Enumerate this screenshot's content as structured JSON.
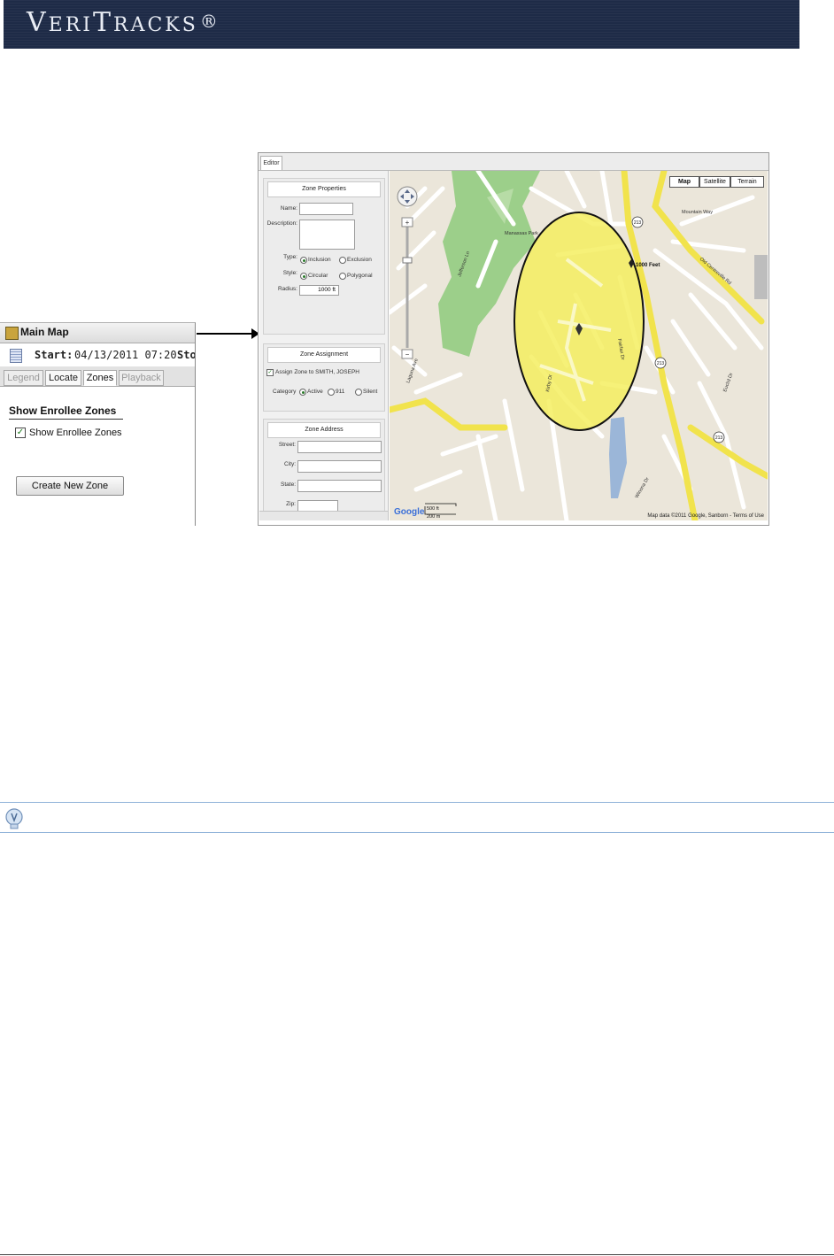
{
  "banner": {
    "brand": "VeriTracks",
    "brand_parts": [
      "V",
      "ERI",
      "T",
      "RACKS"
    ],
    "registered": "®",
    "bg_color": "#1e2b47"
  },
  "main_map_panel": {
    "title": "Main Map",
    "start_label": "Start:",
    "start_value": "04/13/2011 07:20",
    "stop_label": "Sto",
    "tabs": [
      {
        "label": "Legend",
        "state": "disabled"
      },
      {
        "label": "Locate",
        "state": "enabled"
      },
      {
        "label": "Zones",
        "state": "active"
      },
      {
        "label": "Playback",
        "state": "disabled"
      }
    ],
    "zones_heading": "Show Enrollee Zones",
    "show_zones_checkbox": {
      "label": "Show Enrollee Zones",
      "checked": true
    },
    "create_button": "Create New Zone"
  },
  "editor": {
    "tab": "Editor",
    "zone_properties": {
      "title": "Zone Properties",
      "name_label": "Name:",
      "name_value": "",
      "description_label": "Description:",
      "description_value": "",
      "type_label": "Type:",
      "type_options": [
        "Inclusion",
        "Exclusion"
      ],
      "type_selected": "Inclusion",
      "style_label": "Style:",
      "style_options": [
        "Circular",
        "Polygonal"
      ],
      "style_selected": "Circular",
      "radius_label": "Radius:",
      "radius_value": "1000 ft"
    },
    "zone_assignment": {
      "title": "Zone Assignment",
      "assign_label": "Assign Zone to SMITH, JOSEPH",
      "assign_checked": true,
      "category_label": "Category",
      "category_options": [
        "Active",
        "911",
        "Silent"
      ],
      "category_selected": "Active"
    },
    "zone_address": {
      "title": "Zone Address",
      "street_label": "Street:",
      "city_label": "City:",
      "state_label": "State:",
      "zip_label": "Zip:"
    },
    "map": {
      "map_types": [
        "Map",
        "Satellite",
        "Terrain"
      ],
      "selected_map_type": "Map",
      "radius_tag": "1000 Feet",
      "scale_ft": "500 ft",
      "scale_m": "200 m",
      "logo": "Google",
      "copyright": "Map data ©2011 Google, Sanborn - Terms of Use",
      "zone_fill_color": "#f4ee5a",
      "park_color": "#9ccf8a",
      "highway_color": "#f1e34c",
      "road_labels": {
        "route_213_a": "213",
        "route_213_b": "213",
        "route_213_c": "213",
        "fairfax": "Fairfax Dr",
        "mountain_way": "Mountain Way",
        "manassas": "Manassas Park",
        "old_centreville": "Old Centreville Rd",
        "laguna": "Laguna Ave",
        "kirby": "Kirby Dr",
        "euclid": "Euclid Dr",
        "jefferson": "Jefferson Ln",
        "winona": "Winona Dr"
      }
    }
  },
  "tip_bar": {
    "icon": "lightbulb-icon"
  }
}
